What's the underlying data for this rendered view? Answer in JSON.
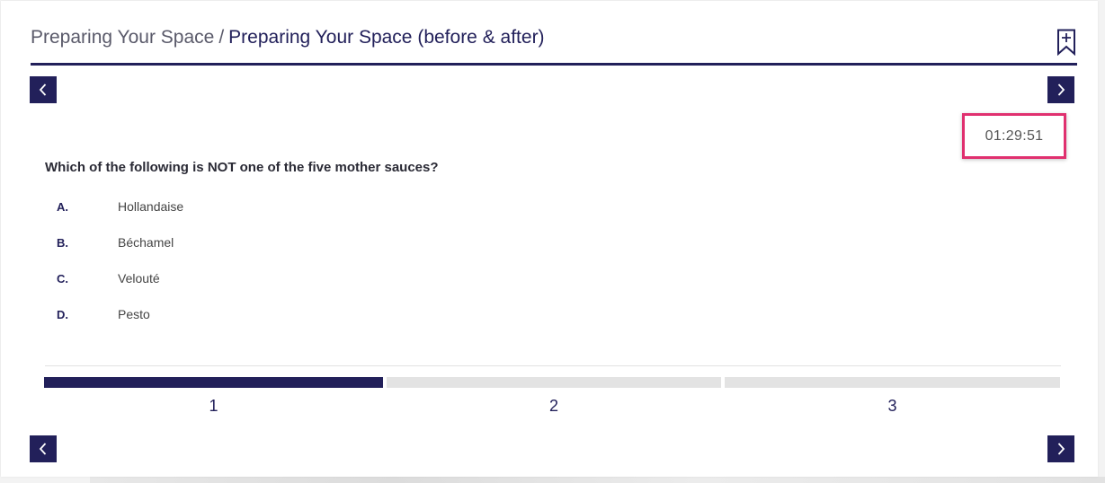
{
  "breadcrumb": {
    "parent": "Preparing Your Space",
    "separator": "/",
    "current": "Preparing Your Space (before & after)"
  },
  "timer": {
    "value": "01:29:51"
  },
  "question": {
    "text": "Which of the following is NOT one of the five mother sauces?",
    "options": [
      {
        "letter": "A.",
        "text": "Hollandaise"
      },
      {
        "letter": "B.",
        "text": "Béchamel"
      },
      {
        "letter": "C.",
        "text": "Velouté"
      },
      {
        "letter": "D.",
        "text": "Pesto"
      }
    ]
  },
  "progress": {
    "steps": [
      {
        "label": "1",
        "active": true
      },
      {
        "label": "2",
        "active": false
      },
      {
        "label": "3",
        "active": false
      }
    ]
  },
  "icons": {
    "bookmark": "bookmark-add-icon",
    "prev": "chevron-left-icon",
    "next": "chevron-right-icon"
  },
  "colors": {
    "primary": "#22205a",
    "highlight": "#e0306f",
    "inactive_step": "#e3e3e3",
    "text": "#444444"
  }
}
